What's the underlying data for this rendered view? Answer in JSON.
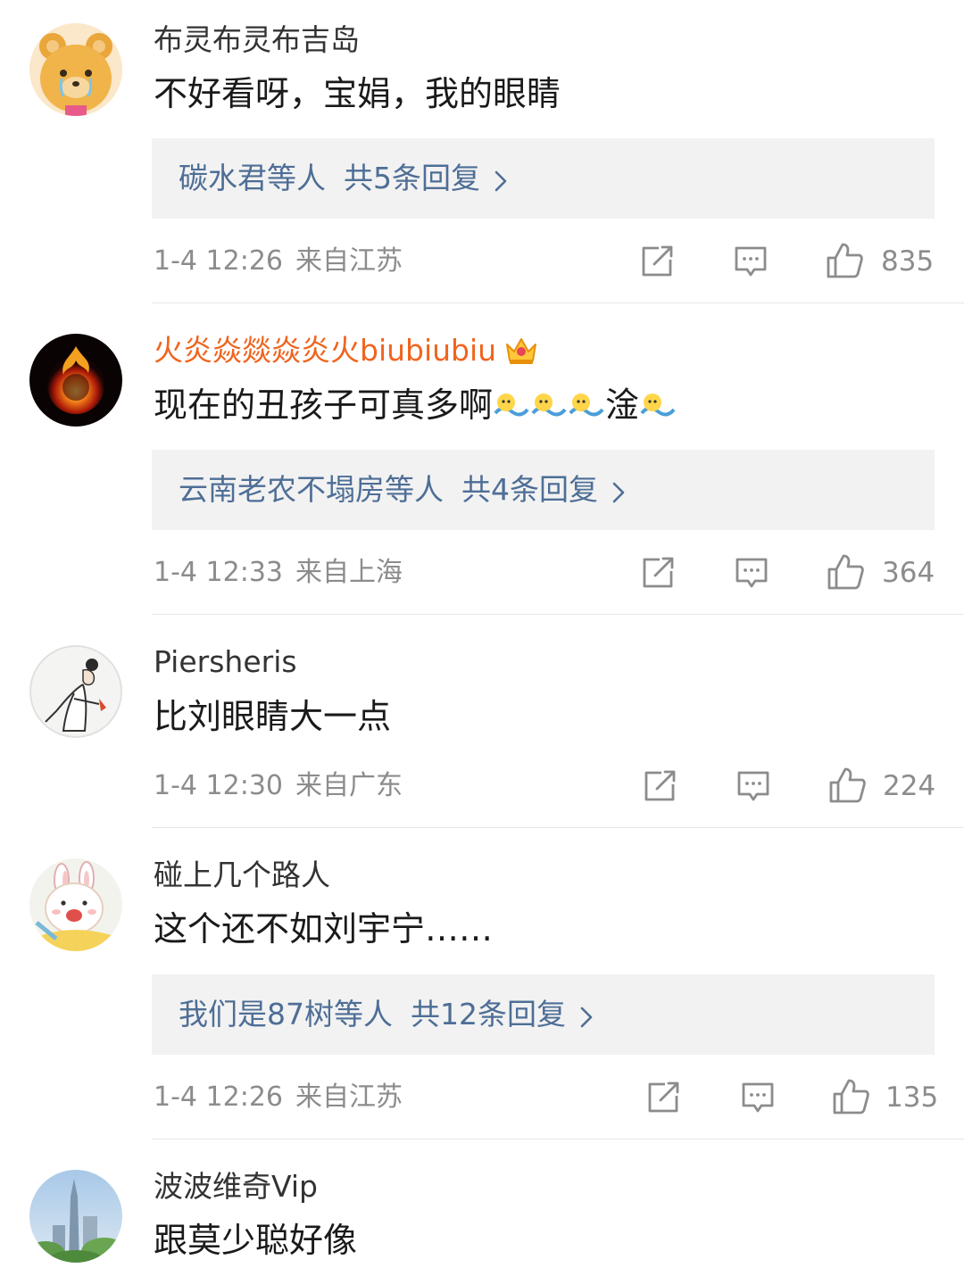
{
  "comments": [
    {
      "username": "布灵布灵布吉岛",
      "text": "不好看呀，宝娟，我的眼睛",
      "replies": {
        "who": "碳水君",
        "suffix": "等人",
        "count": "共5条回复"
      },
      "time": "1-4 12:26",
      "location": "来自江苏",
      "likes": "835"
    },
    {
      "username": "火炎焱燚焱炎火biubiubiu",
      "text": "现在的丑孩子可真多啊",
      "text_tail": "淦",
      "replies": {
        "who": "云南老农不塌房",
        "suffix": "等人",
        "count": "共4条回复"
      },
      "time": "1-4 12:33",
      "location": "来自上海",
      "likes": "364"
    },
    {
      "username": "Piersheris",
      "text": "比刘眼睛大一点",
      "time": "1-4 12:30",
      "location": "来自广东",
      "likes": "224"
    },
    {
      "username": "碰上几个路人",
      "text": "这个还不如刘宇宁……",
      "replies": {
        "who": "我们是87树",
        "suffix": "等人",
        "count": "共12条回复"
      },
      "time": "1-4 12:26",
      "location": "来自江苏",
      "likes": "135"
    },
    {
      "username": "波波维奇Vip",
      "text": "跟莫少聪好像"
    }
  ],
  "colors": {
    "link_blue": "#4e6e96",
    "vip_orange": "#f0641e",
    "meta_gray": "#8c8c8c",
    "reply_bg": "#f2f2f2"
  },
  "icons": [
    "share-icon",
    "comment-icon",
    "like-icon",
    "chevron-right-icon",
    "crown-icon",
    "emoji-icon"
  ]
}
